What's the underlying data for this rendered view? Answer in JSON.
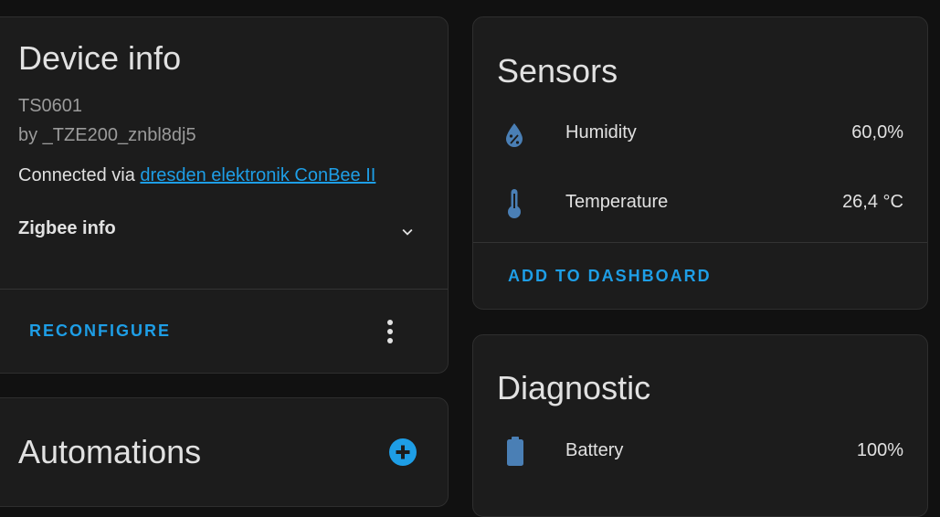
{
  "device_info": {
    "title": "Device info",
    "model": "TS0601",
    "manufacturer": "by _TZE200_znbl8dj5",
    "connected_prefix": "Connected via ",
    "connected_link": "dresden elektronik ConBee II",
    "zigbee_label": "Zigbee info",
    "reconfigure_label": "RECONFIGURE"
  },
  "automations": {
    "title": "Automations"
  },
  "sensors": {
    "title": "Sensors",
    "rows": [
      {
        "label": "Humidity",
        "value": "60,0%",
        "icon": "water-percent-icon"
      },
      {
        "label": "Temperature",
        "value": "26,4 °C",
        "icon": "thermometer-icon"
      }
    ],
    "add_label": "ADD TO DASHBOARD"
  },
  "diagnostic": {
    "title": "Diagnostic",
    "rows": [
      {
        "label": "Battery",
        "value": "100%",
        "icon": "battery-icon"
      }
    ]
  },
  "colors": {
    "accent": "#1e9ee6",
    "icon": "#4a7fb5",
    "card_bg": "#1c1c1c",
    "page_bg": "#111111"
  }
}
